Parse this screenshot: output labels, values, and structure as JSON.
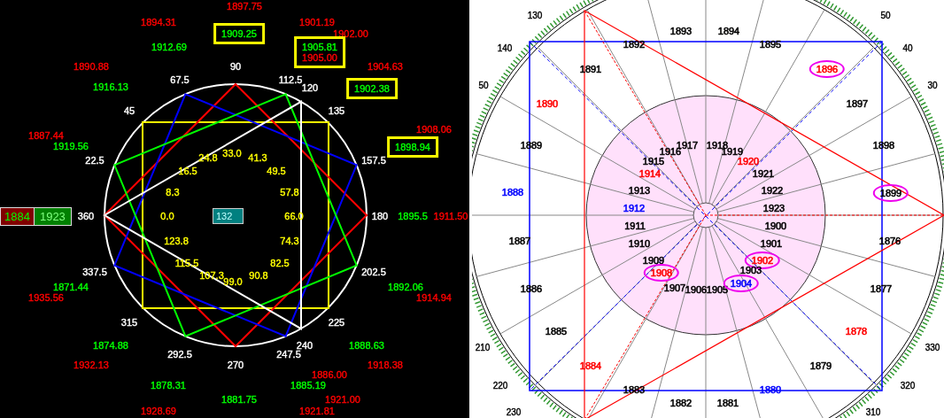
{
  "left_chart": {
    "price_groups": [
      {
        "boxed": false,
        "items": [
          {
            "text": "1897.75",
            "color": "#ff0000"
          }
        ]
      },
      {
        "boxed": false,
        "items": [
          {
            "text": "1894.31",
            "color": "#ff0000"
          }
        ]
      },
      {
        "boxed": true,
        "items": [
          {
            "text": "1909.25",
            "color": "#00ff00"
          }
        ]
      },
      {
        "boxed": false,
        "items": [
          {
            "text": "1901.19",
            "color": "#ff0000"
          }
        ]
      },
      {
        "boxed": false,
        "items": [
          {
            "text": "1902.00",
            "color": "#ff0000"
          }
        ]
      },
      {
        "boxed": false,
        "items": [
          {
            "text": "1912.69",
            "color": "#00ff00"
          }
        ]
      },
      {
        "boxed": true,
        "items": [
          {
            "text": "1905.81",
            "color": "#00ff00"
          },
          {
            "text": "1905.00",
            "color": "#ff0000"
          }
        ]
      },
      {
        "boxed": false,
        "items": [
          {
            "text": "1890.88",
            "color": "#ff0000"
          }
        ]
      },
      {
        "boxed": false,
        "items": [
          {
            "text": "1904.63",
            "color": "#ff0000"
          }
        ]
      },
      {
        "boxed": false,
        "items": [
          {
            "text": "1916.13",
            "color": "#00ff00"
          }
        ]
      },
      {
        "boxed": true,
        "items": [
          {
            "text": "1902.38",
            "color": "#00ff00"
          }
        ]
      },
      {
        "boxed": false,
        "items": [
          {
            "text": "1887.44",
            "color": "#ff0000"
          }
        ]
      },
      {
        "boxed": false,
        "items": [
          {
            "text": "1908.06",
            "color": "#ff0000"
          }
        ]
      },
      {
        "boxed": true,
        "items": [
          {
            "text": "1898.94",
            "color": "#00ff00"
          }
        ]
      },
      {
        "boxed": false,
        "items": [
          {
            "text": "1919.56",
            "color": "#00ff00"
          }
        ]
      },
      {
        "boxed": false,
        "items": [
          {
            "text": "1895.5",
            "color": "#00ff00"
          }
        ]
      },
      {
        "boxed": false,
        "items": [
          {
            "text": "1911.50",
            "color": "#ff0000"
          }
        ]
      },
      {
        "boxed": false,
        "items": [
          {
            "text": "1871.44",
            "color": "#00ff00"
          }
        ]
      },
      {
        "boxed": false,
        "items": [
          {
            "text": "1892.06",
            "color": "#00ff00"
          }
        ]
      },
      {
        "boxed": false,
        "items": [
          {
            "text": "1935.56",
            "color": "#ff0000"
          }
        ]
      },
      {
        "boxed": false,
        "items": [
          {
            "text": "1914.94",
            "color": "#ff0000"
          }
        ]
      },
      {
        "boxed": false,
        "items": [
          {
            "text": "1874.88",
            "color": "#00ff00"
          }
        ]
      },
      {
        "boxed": false,
        "items": [
          {
            "text": "1888.63",
            "color": "#00ff00"
          }
        ]
      },
      {
        "boxed": false,
        "items": [
          {
            "text": "1932.13",
            "color": "#ff0000"
          }
        ]
      },
      {
        "boxed": false,
        "items": [
          {
            "text": "1918.38",
            "color": "#ff0000"
          }
        ]
      },
      {
        "boxed": false,
        "items": [
          {
            "text": "1886.00",
            "color": "#ff0000"
          }
        ]
      },
      {
        "boxed": false,
        "items": [
          {
            "text": "1878.31",
            "color": "#00ff00"
          }
        ]
      },
      {
        "boxed": false,
        "items": [
          {
            "text": "1885.19",
            "color": "#00ff00"
          }
        ]
      },
      {
        "boxed": false,
        "items": [
          {
            "text": "1881.75",
            "color": "#00ff00"
          }
        ]
      },
      {
        "boxed": false,
        "items": [
          {
            "text": "1921.00",
            "color": "#ff0000"
          }
        ]
      },
      {
        "boxed": false,
        "items": [
          {
            "text": "1928.69",
            "color": "#ff0000"
          }
        ]
      },
      {
        "boxed": false,
        "items": [
          {
            "text": "1921.81",
            "color": "#ff0000"
          }
        ]
      }
    ],
    "angle_labels": [
      "90",
      "67.5",
      "112.5",
      "120",
      "45",
      "135",
      "22.5",
      "157.5",
      "360",
      "180",
      "337.5",
      "202.5",
      "315",
      "225",
      "240",
      "292.5",
      "247.5",
      "270"
    ],
    "inner_labels": [
      "24.8",
      "33.0",
      "41.3",
      "16.5",
      "49.5",
      "8.3",
      "57.8",
      "0.0",
      "66.0",
      "123.8",
      "74.3",
      "115.5",
      "82.5",
      "107.3",
      "99.0",
      "90.8"
    ],
    "center_value": "132",
    "range_low": "1884",
    "range_high": "1923"
  },
  "right_chart": {
    "scale_labels": [
      "130",
      "140",
      "50",
      "50",
      "40",
      "30",
      "210",
      "220",
      "230",
      "330",
      "320",
      "310"
    ],
    "year_labels": [
      {
        "text": "1893",
        "color": "#000000",
        "circled": false
      },
      {
        "text": "1894",
        "color": "#000000",
        "circled": false
      },
      {
        "text": "1892",
        "color": "#000000",
        "circled": false
      },
      {
        "text": "1895",
        "color": "#000000",
        "circled": false
      },
      {
        "text": "1891",
        "color": "#000000",
        "circled": false
      },
      {
        "text": "1896",
        "color": "#ff0000",
        "circled": true
      },
      {
        "text": "1890",
        "color": "#ff0000",
        "circled": false
      },
      {
        "text": "1897",
        "color": "#000000",
        "circled": false
      },
      {
        "text": "1889",
        "color": "#000000",
        "circled": false
      },
      {
        "text": "1917",
        "color": "#000000",
        "circled": false
      },
      {
        "text": "1918",
        "color": "#000000",
        "circled": false
      },
      {
        "text": "1898",
        "color": "#000000",
        "circled": false
      },
      {
        "text": "1916",
        "color": "#000000",
        "circled": false
      },
      {
        "text": "1919",
        "color": "#000000",
        "circled": false
      },
      {
        "text": "1915",
        "color": "#000000",
        "circled": false
      },
      {
        "text": "1920",
        "color": "#ff0000",
        "circled": false
      },
      {
        "text": "1914",
        "color": "#ff0000",
        "circled": false
      },
      {
        "text": "1921",
        "color": "#000000",
        "circled": false
      },
      {
        "text": "1888",
        "color": "#0000ff",
        "circled": false
      },
      {
        "text": "1913",
        "color": "#000000",
        "circled": false
      },
      {
        "text": "1922",
        "color": "#000000",
        "circled": false
      },
      {
        "text": "1899",
        "color": "#000000",
        "circled": true
      },
      {
        "text": "1912",
        "color": "#0000ff",
        "circled": false
      },
      {
        "text": "1923",
        "color": "#000000",
        "circled": false
      },
      {
        "text": "1911",
        "color": "#000000",
        "circled": false
      },
      {
        "text": "1900",
        "color": "#000000",
        "circled": false
      },
      {
        "text": "1887",
        "color": "#000000",
        "circled": false
      },
      {
        "text": "1910",
        "color": "#000000",
        "circled": false
      },
      {
        "text": "1901",
        "color": "#000000",
        "circled": false
      },
      {
        "text": "1876",
        "color": "#000000",
        "circled": false
      },
      {
        "text": "1909",
        "color": "#000000",
        "circled": false
      },
      {
        "text": "1902",
        "color": "#ff0000",
        "circled": true
      },
      {
        "text": "1908",
        "color": "#ff0000",
        "circled": true
      },
      {
        "text": "1903",
        "color": "#000000",
        "circled": false
      },
      {
        "text": "1886",
        "color": "#000000",
        "circled": false
      },
      {
        "text": "1907",
        "color": "#000000",
        "circled": false
      },
      {
        "text": "1906",
        "color": "#000000",
        "circled": false
      },
      {
        "text": "1905",
        "color": "#000000",
        "circled": false
      },
      {
        "text": "1904",
        "color": "#0000ff",
        "circled": true
      },
      {
        "text": "1877",
        "color": "#000000",
        "circled": false
      },
      {
        "text": "1885",
        "color": "#000000",
        "circled": false
      },
      {
        "text": "1878",
        "color": "#ff0000",
        "circled": false
      },
      {
        "text": "1884",
        "color": "#ff0000",
        "circled": false
      },
      {
        "text": "1879",
        "color": "#000000",
        "circled": false
      },
      {
        "text": "1883",
        "color": "#000000",
        "circled": false
      },
      {
        "text": "1880",
        "color": "#0000ff",
        "circled": false
      },
      {
        "text": "1882",
        "color": "#000000",
        "circled": false
      },
      {
        "text": "1881",
        "color": "#000000",
        "circled": false
      }
    ]
  }
}
